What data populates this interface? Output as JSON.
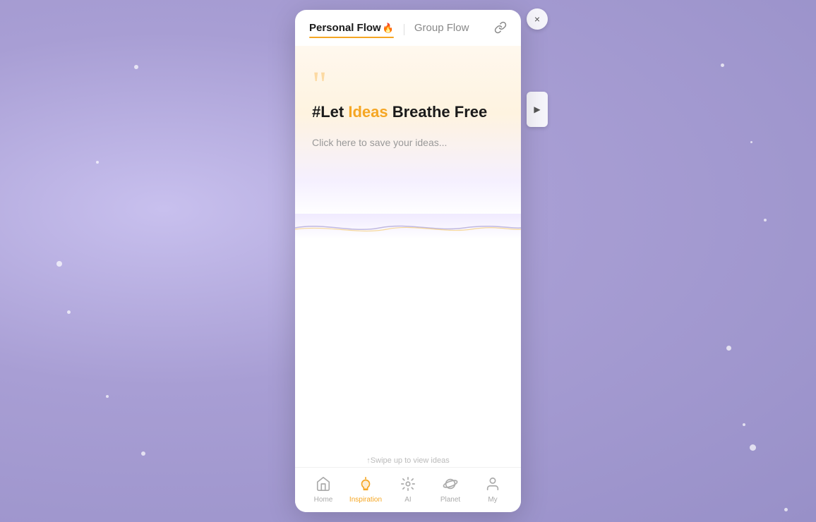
{
  "background": {
    "color": "#b8b0e0"
  },
  "modal": {
    "tabs": [
      {
        "id": "personal-flow",
        "label": "Personal Flow",
        "emoji": "🔥",
        "active": true
      },
      {
        "id": "group-flow",
        "label": "Group Flow",
        "active": false
      }
    ],
    "close_button_label": "×",
    "arrow_button_label": "▶",
    "quote_marks": "““",
    "headline_prefix": "#Let ",
    "headline_highlight": "Ideas",
    "headline_suffix": " Breathe Free",
    "click_hint": "Click here to save your ideas...",
    "swipe_hint": "↑Swipe up to view ideas",
    "bottom_nav": [
      {
        "id": "home",
        "icon": "⌂",
        "label": "Home",
        "active": false
      },
      {
        "id": "inspiration",
        "icon": "💡",
        "label": "Inspiration",
        "active": true
      },
      {
        "id": "ai",
        "icon": "🤖",
        "label": "AI",
        "active": false
      },
      {
        "id": "planet",
        "icon": "🪐",
        "label": "Planet",
        "active": false
      },
      {
        "id": "my",
        "icon": "👤",
        "label": "My",
        "active": false
      }
    ],
    "link_icon": "🔗",
    "colors": {
      "accent": "#f5a623",
      "active_tab": "#1a1a1a",
      "inactive_tab": "#888888"
    }
  }
}
